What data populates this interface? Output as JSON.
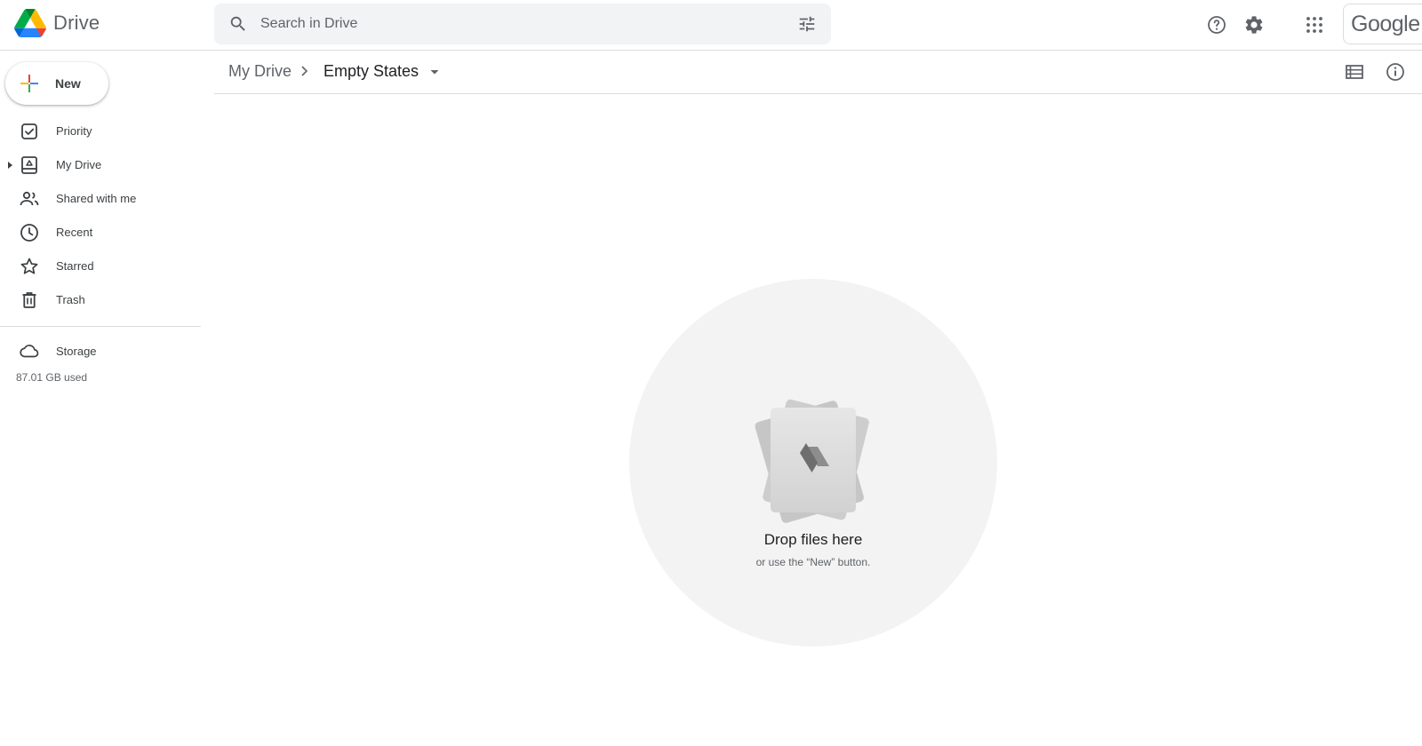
{
  "header": {
    "app_name": "Drive",
    "search_placeholder": "Search in Drive",
    "account_label": "Google"
  },
  "icons": {
    "search": "search-icon",
    "search_options": "tune-icon",
    "support": "help-icon",
    "settings": "gear-icon",
    "apps": "apps-grid-icon"
  },
  "sidebar": {
    "new_label": "New",
    "items": [
      {
        "label": "Priority",
        "icon": "priority-icon"
      },
      {
        "label": "My Drive",
        "icon": "my-drive-icon"
      },
      {
        "label": "Shared with me",
        "icon": "shared-icon"
      },
      {
        "label": "Recent",
        "icon": "clock-icon"
      },
      {
        "label": "Starred",
        "icon": "star-icon"
      },
      {
        "label": "Trash",
        "icon": "trash-icon"
      }
    ],
    "storage_label": "Storage",
    "storage_used": "87.01 GB used"
  },
  "breadcrumb": {
    "root": "My Drive",
    "current": "Empty States"
  },
  "empty_state": {
    "title": "Drop files here",
    "subtitle": "or use the “New” button."
  },
  "colors": {
    "blue": "#4285f4",
    "green": "#34a853",
    "yellow": "#fbbc04",
    "red": "#ea4335",
    "icon_gray": "#5f6368"
  }
}
